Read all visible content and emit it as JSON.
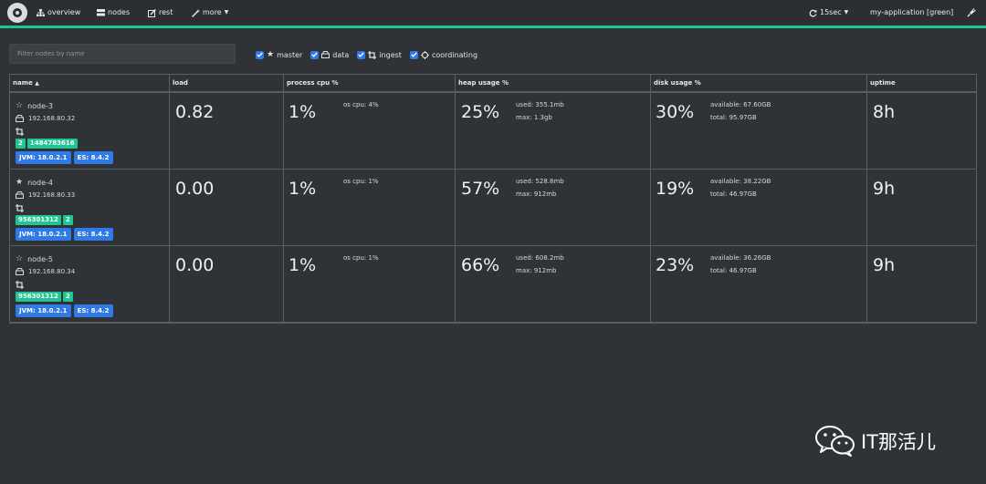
{
  "nav": {
    "overview": "overview",
    "nodes": "nodes",
    "rest": "rest",
    "more": "more",
    "refresh": "15sec",
    "cluster": "my-application [green]"
  },
  "filter": {
    "placeholder": "Filter nodes by name",
    "value": ""
  },
  "roles": [
    {
      "label": "master",
      "checked": true
    },
    {
      "label": "data",
      "checked": true
    },
    {
      "label": "ingest",
      "checked": true
    },
    {
      "label": "coordinating",
      "checked": true
    }
  ],
  "columns": [
    "name",
    "load",
    "process cpu %",
    "heap usage %",
    "disk usage %",
    "uptime"
  ],
  "nodes": [
    {
      "name": "node-3",
      "master": false,
      "ip": "192.168.80.32",
      "badges": [
        "2",
        "1484783616"
      ],
      "jvm": "JVM: 18.0.2.1",
      "es": "ES: 8.4.2",
      "load": "0.82",
      "cpu": "1%",
      "os_cpu": "os cpu: 4%",
      "heap": "25%",
      "heap_used": "used: 355.1mb",
      "heap_max": "max: 1.3gb",
      "disk": "30%",
      "disk_avail": "available: 67.60GB",
      "disk_total": "total: 95.97GB",
      "uptime": "8h"
    },
    {
      "name": "node-4",
      "master": true,
      "ip": "192.168.80.33",
      "badges": [
        "956301312",
        "2"
      ],
      "jvm": "JVM: 18.0.2.1",
      "es": "ES: 8.4.2",
      "load": "0.00",
      "cpu": "1%",
      "os_cpu": "os cpu: 1%",
      "heap": "57%",
      "heap_used": "used: 528.8mb",
      "heap_max": "max: 912mb",
      "disk": "19%",
      "disk_avail": "available: 38.22GB",
      "disk_total": "total: 46.97GB",
      "uptime": "9h"
    },
    {
      "name": "node-5",
      "master": false,
      "ip": "192.168.80.34",
      "badges": [
        "956301312",
        "2"
      ],
      "jvm": "JVM: 18.0.2.1",
      "es": "ES: 8.4.2",
      "load": "0.00",
      "cpu": "1%",
      "os_cpu": "os cpu: 1%",
      "heap": "66%",
      "heap_used": "used: 608.2mb",
      "heap_max": "max: 912mb",
      "disk": "23%",
      "disk_avail": "available: 36.26GB",
      "disk_total": "total: 46.97GB",
      "uptime": "9h"
    }
  ],
  "watermark": "IT那活儿",
  "colors": {
    "accent": "#1fc592",
    "tag": "#2f7ae5",
    "background": "#2f3236"
  }
}
